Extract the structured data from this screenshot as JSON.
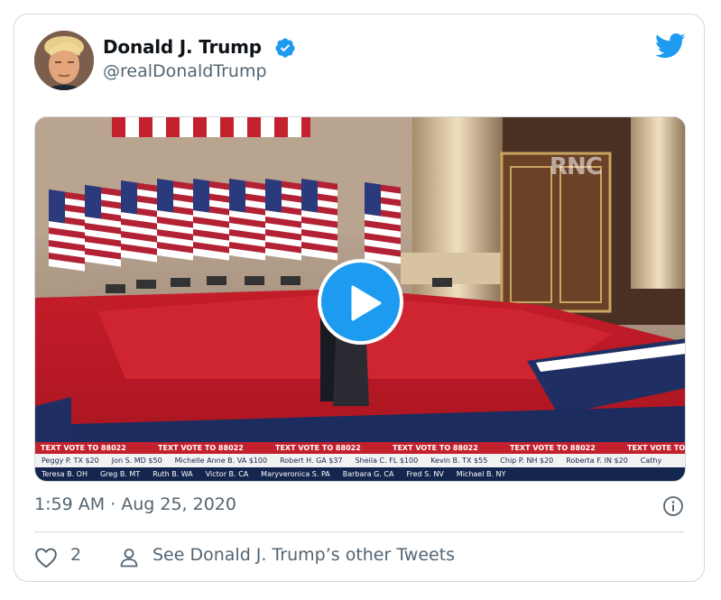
{
  "tweet": {
    "author_name": "Donald J. Trump",
    "handle": "@realDonaldTrump",
    "timestamp": "1:59 AM · Aug 25, 2020",
    "like_count": "2",
    "other_tweets_label": "See Donald J. Trump’s other Tweets"
  },
  "video": {
    "watermark": "RNC",
    "ticker_top": [
      "TEXT VOTE TO 88022",
      "TEXT VOTE TO 88022",
      "TEXT VOTE TO 88022",
      "TEXT VOTE TO 88022",
      "TEXT VOTE TO 88022",
      "TEXT VOTE TO"
    ],
    "ticker_mid": [
      "Peggy P. TX $20",
      "Jon S. MD $50",
      "Michelle Anne B. VA $100",
      "Robert H. GA $37",
      "Sheila C. FL $100",
      "Kevin B. TX $55",
      "Chip P. NH $20",
      "Roberta F. IN $20",
      "Cathy"
    ],
    "ticker_bottom": [
      "Teresa B. OH",
      "Greg B. MT",
      "Ruth B. WA",
      "Victor B. CA",
      "Maryveronica S. PA",
      "Barbara G. CA",
      "Fred S. NV",
      "Michael B. NY"
    ]
  },
  "colors": {
    "accent": "#1d9bf0",
    "text_primary": "#0f1419",
    "text_secondary": "#536471",
    "border": "#cfd9de",
    "stage_red": "#c4212e",
    "navy": "#14264d"
  },
  "icons": {
    "verified": "verified-badge-icon",
    "brand": "twitter-bird-icon",
    "play": "play-icon",
    "info": "info-icon",
    "like": "heart-icon",
    "profile": "person-icon"
  }
}
